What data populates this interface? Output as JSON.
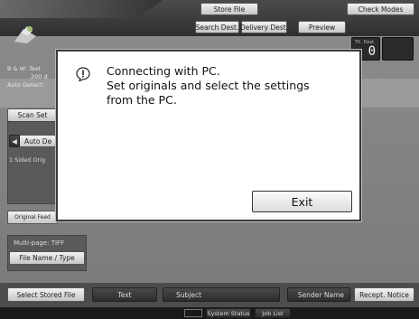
{
  "top": {
    "store_file": "Store File",
    "check_modes": "Check Modes",
    "search_dest": "Search Dest.",
    "delivery_dest": "Delivery Dest.",
    "preview": "Preview",
    "counter_label": "Ttl. Dest.",
    "counter_value": "0"
  },
  "side": {
    "line1": "B & W: Text",
    "line2": "200 d",
    "line3": "Auto Detect:",
    "scan_settings": "Scan Set",
    "auto_density": "Auto De",
    "one_sided": "1 Sided Orig",
    "original_feed": "Original Feed",
    "multi_page": "Multi-page: TIFF",
    "file_name_type": "File Name / Type"
  },
  "dialog": {
    "lines": [
      "Connecting with PC.",
      "Set originals and select the settings",
      "from the PC."
    ],
    "exit_label": "Exit"
  },
  "bottom": {
    "select_stored_file": "Select Stored File",
    "text": "Text",
    "subject": "Subject",
    "sender_name": "Sender Name",
    "recept_notice": "Recept. Notice"
  },
  "status": {
    "system_status": "System Status",
    "job_list": "Job List"
  }
}
